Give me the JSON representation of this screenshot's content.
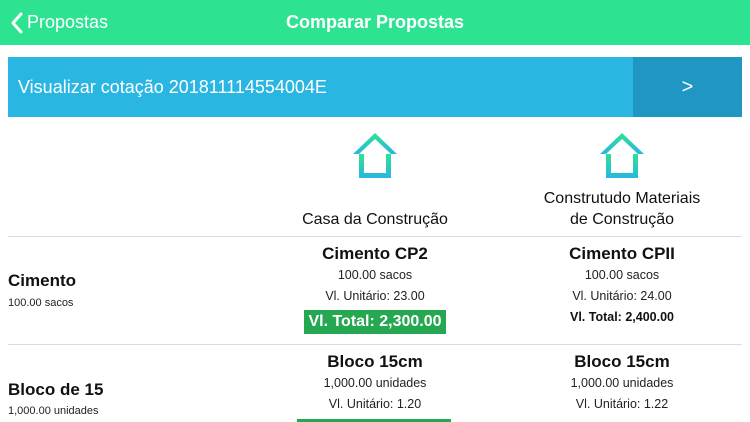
{
  "nav": {
    "back_label": "Propostas",
    "title": "Comparar Propostas"
  },
  "quote": {
    "label": "Visualizar cotação 201811114554004E",
    "arrow": ">"
  },
  "suppliers": [
    {
      "name": "Casa da Construção"
    },
    {
      "name_line1": "Construtudo Materiais",
      "name_line2": "de Construção"
    }
  ],
  "items": [
    {
      "name": "Cimento",
      "quantity": "100.00 sacos",
      "offers": [
        {
          "product": "Cimento CP2",
          "quantity": "100.00 sacos",
          "unit_price": "Vl. Unitário: 23.00",
          "total": "Vl. Total: 2,300.00",
          "best": true
        },
        {
          "product": "Cimento CPII",
          "quantity": "100.00 sacos",
          "unit_price": "Vl. Unitário: 24.00",
          "total": "Vl. Total: 2,400.00",
          "best": false
        }
      ]
    },
    {
      "name": "Bloco de 15",
      "quantity": "1,000.00 unidades",
      "offers": [
        {
          "product": "Bloco 15cm",
          "quantity": "1,000.00 unidades",
          "unit_price": "Vl. Unitário: 1.20",
          "best": true
        },
        {
          "product": "Bloco 15cm",
          "quantity": "1,000.00 unidades",
          "unit_price": "Vl. Unitário: 1.22",
          "best": false
        }
      ]
    }
  ],
  "colors": {
    "nav_bg": "#2de392",
    "banner_bg": "#2ab6e3",
    "banner_arrow_bg": "#1f97c2",
    "best_price": "#26a751"
  },
  "icons": {
    "back": "chevron-left-icon",
    "supplier": "house-icon"
  }
}
